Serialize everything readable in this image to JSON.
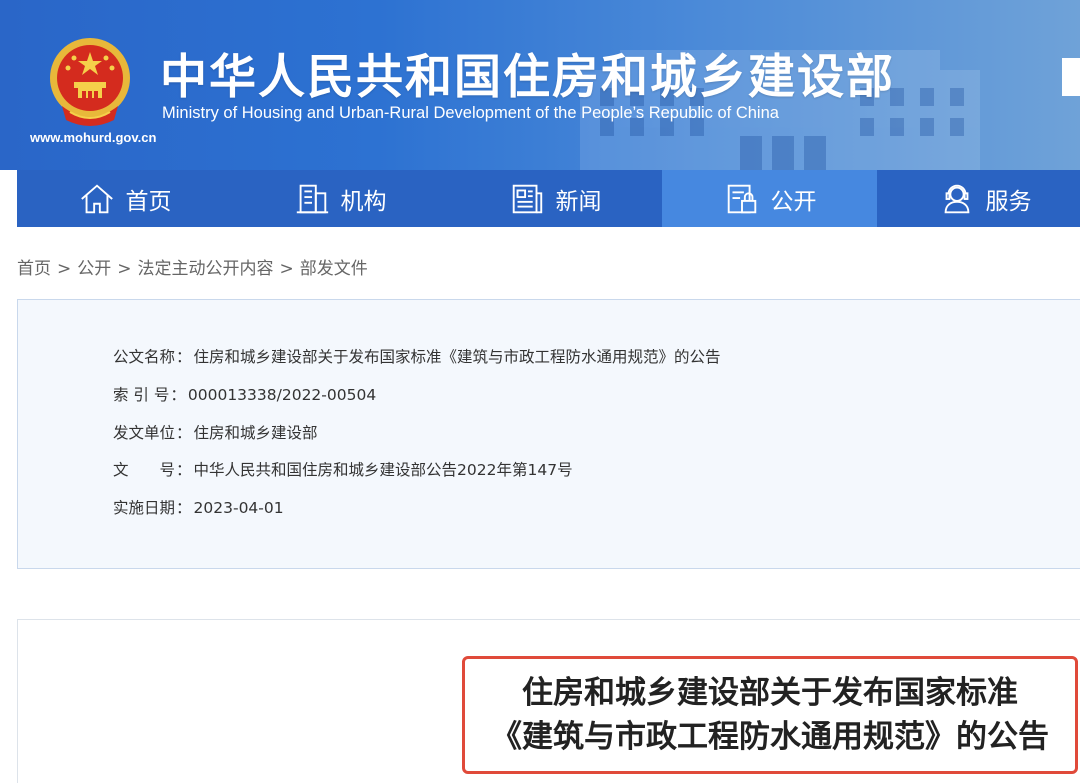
{
  "header": {
    "title_cn": "中华人民共和国住房和城乡建设部",
    "title_en": "Ministry of Housing and Urban-Rural Development of the People’s Republic of China",
    "url": "www.mohurd.gov.cn",
    "emblem_icon": "national-emblem-icon"
  },
  "nav": {
    "items": [
      {
        "label": "首页",
        "icon": "home-icon"
      },
      {
        "label": "机构",
        "icon": "building-icon"
      },
      {
        "label": "新闻",
        "icon": "newspaper-icon"
      },
      {
        "label": "公开",
        "icon": "document-lock-icon",
        "active": true
      },
      {
        "label": "服务",
        "icon": "user-service-icon"
      }
    ]
  },
  "breadcrumb": {
    "items": [
      "首页",
      "公开",
      "法定主动公开内容",
      "部发文件"
    ],
    "separator": ">"
  },
  "info": {
    "rows": [
      {
        "label": "公文名称",
        "value": "住房和城乡建设部关于发布国家标准《建筑与市政工程防水通用规范》的公告"
      },
      {
        "label": "索 引 号",
        "value": "000013338/2022-00504"
      },
      {
        "label": "发文单位",
        "value": "住房和城乡建设部"
      },
      {
        "label": "文　　号",
        "value": "中华人民共和国住房和城乡建设部公告2022年第147号"
      },
      {
        "label": "实施日期",
        "value": "2023-04-01"
      }
    ],
    "colon": "："
  },
  "document": {
    "title_line1": "住房和城乡建设部关于发布国家标准",
    "title_line2": "《建筑与市政工程防水通用规范》的公告"
  },
  "colors": {
    "banner": "#2d72d2",
    "nav_bg": "#2a63c2",
    "nav_active": "#4688e0",
    "highlight_border": "#e04a3a",
    "info_bg": "#f4f8fd"
  }
}
